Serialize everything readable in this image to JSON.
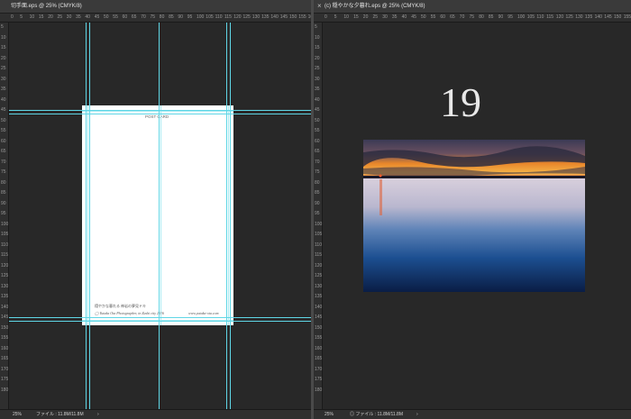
{
  "left_doc": {
    "tab_title": "切手面.eps @ 25% (CMYK/8)",
    "zoom": "25%",
    "file_info": "ファイル : 11.8M/11.8M",
    "ruler_h": [
      "0",
      "5",
      "10",
      "15",
      "20",
      "25",
      "30",
      "35",
      "40",
      "45",
      "50",
      "55",
      "60",
      "65",
      "70",
      "75",
      "80",
      "85",
      "90",
      "95",
      "100",
      "105",
      "110",
      "115",
      "120",
      "125",
      "130",
      "135",
      "140",
      "145",
      "150",
      "155",
      "160",
      "165"
    ],
    "ruler_v": [
      "5",
      "10",
      "15",
      "20",
      "25",
      "30",
      "35",
      "40",
      "45",
      "50",
      "55",
      "60",
      "65",
      "70",
      "75",
      "80",
      "85",
      "90",
      "95",
      "100",
      "105",
      "110",
      "115",
      "120",
      "125",
      "130",
      "135",
      "140",
      "145",
      "150",
      "155",
      "160",
      "165",
      "170",
      "175",
      "180"
    ],
    "postcard": {
      "heading": "POST CARD",
      "credit_line1": "穏やかな暮れる   神岩の夢見ドキ",
      "credit_line2": "◯ Yutaka Ota Photographer, in Zushi city 2016",
      "website": "www.yutaka-ota.com"
    }
  },
  "right_doc": {
    "tab_title": "(c) 穏やかな夕暮れ.eps @ 25% (CMYK/8)",
    "close_icon_glyph": "×",
    "zoom": "25%",
    "file_info": "◎ ファイル : 11.8M/11.8M",
    "page_number": "19",
    "ruler_h": [
      "0",
      "5",
      "10",
      "15",
      "20",
      "25",
      "30",
      "35",
      "40",
      "45",
      "50",
      "55",
      "60",
      "65",
      "70",
      "75",
      "80",
      "85",
      "90",
      "95",
      "100",
      "105",
      "110",
      "115",
      "120",
      "125",
      "130",
      "135",
      "140",
      "145",
      "150",
      "155"
    ],
    "ruler_v": [
      "5",
      "10",
      "15",
      "20",
      "25",
      "30",
      "35",
      "40",
      "45",
      "50",
      "55",
      "60",
      "65",
      "70",
      "75",
      "80",
      "85",
      "90",
      "95",
      "100",
      "105",
      "110",
      "115",
      "120",
      "125",
      "130",
      "135",
      "140",
      "145",
      "150",
      "155",
      "160",
      "165",
      "170",
      "175",
      "180"
    ],
    "photo_description_colors": {
      "sky_top": "#3a3a5a",
      "sunset": "#f29a2e",
      "horizon_red": "#c8431f",
      "water_light": "#c9c3d6",
      "water_deep": "#0d3b7a"
    }
  },
  "colors": {
    "workspace": "#282828",
    "guide": "#5fd6e6",
    "panel": "#3a3a3a"
  }
}
